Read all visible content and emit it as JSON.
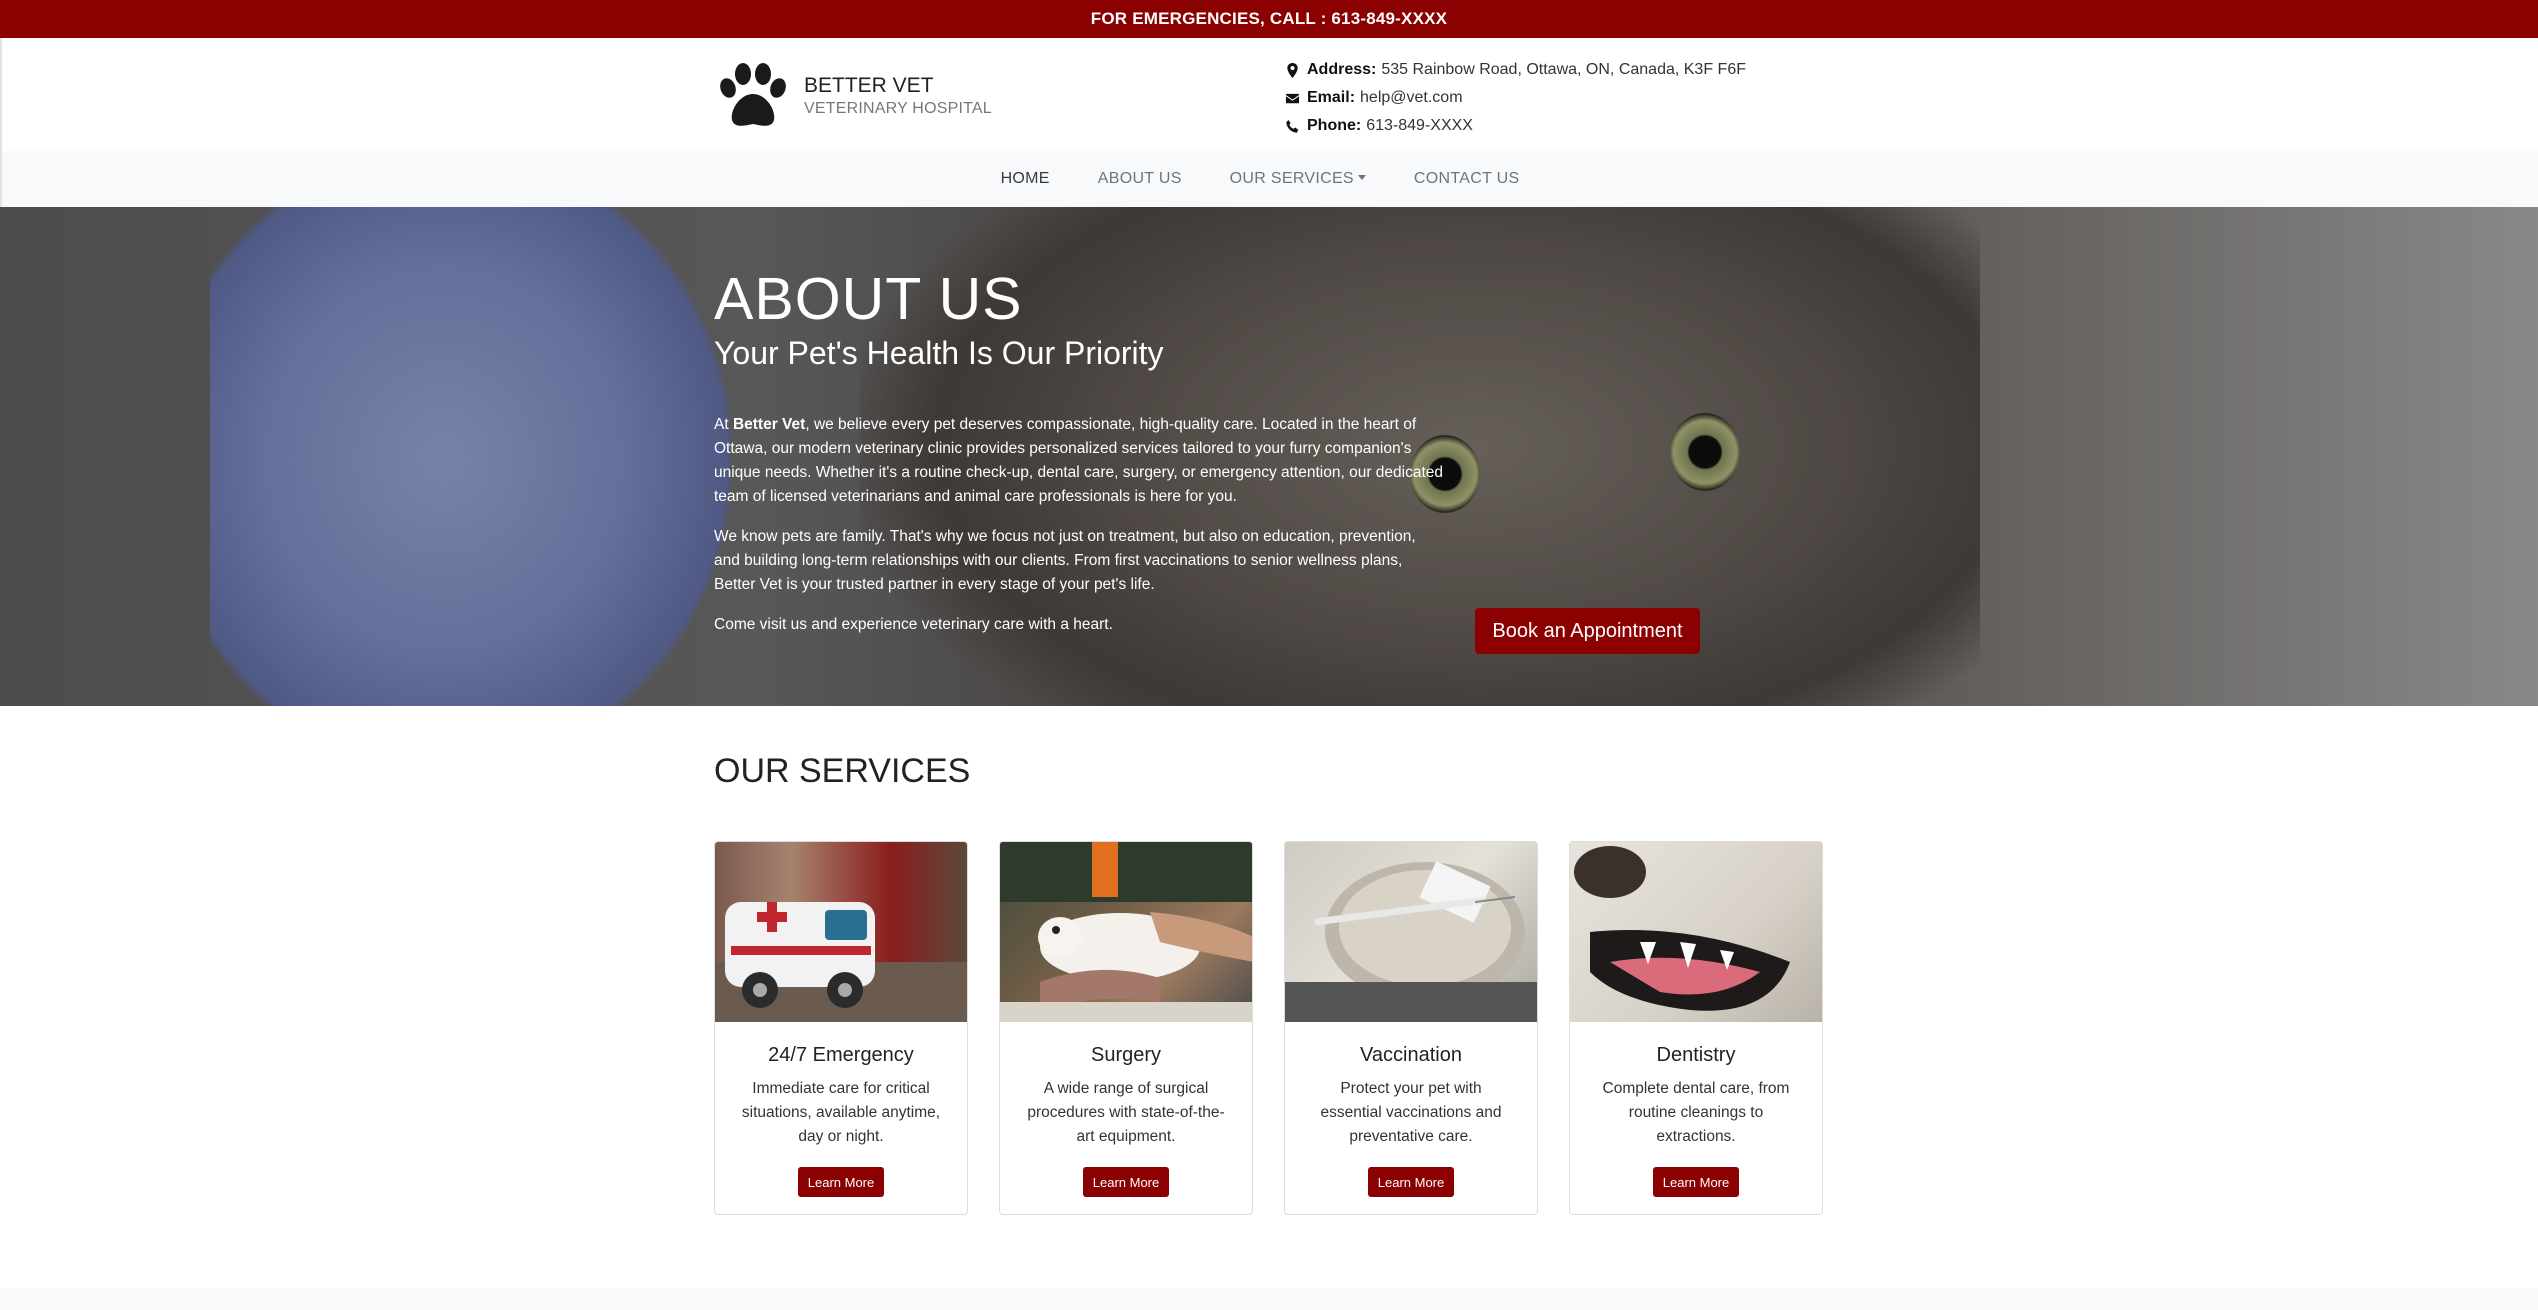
{
  "emergency": {
    "text": "FOR EMERGENCIES, CALL : 613-849-XXXX"
  },
  "brand": {
    "name": "BETTER VET",
    "tagline": "VETERINARY HOSPITAL",
    "logo_icon": "paw-icon"
  },
  "contact": {
    "address_label": "Address:",
    "address": "535 Rainbow Road, Ottawa, ON, Canada, K3F F6F",
    "email_label": "Email:",
    "email": "help@vet.com",
    "phone_label": "Phone:",
    "phone": "613-849-XXXX"
  },
  "nav": {
    "home": "HOME",
    "about": "ABOUT US",
    "services": "OUR SERVICES",
    "contact": "CONTACT US"
  },
  "hero": {
    "title": "ABOUT US",
    "subtitle": "Your Pet's Health Is Our Priority",
    "p1_prefix": "At ",
    "p1_brand": "Better Vet",
    "p1_rest": ", we believe every pet deserves compassionate, high-quality care. Located in the heart of Ottawa, our modern veterinary clinic provides personalized services tailored to your furry companion's unique needs. Whether it's a routine check-up, dental care, surgery, or emergency attention, our dedicated team of licensed veterinarians and animal care professionals is here for you.",
    "p2": "We know pets are family. That's why we focus not just on treatment, but also on education, prevention, and building long-term relationships with our clients. From first vaccinations to senior wellness plans, Better Vet is your trusted partner in every stage of your pet's life.",
    "p3": "Come visit us and experience veterinary care with a heart.",
    "cta": "Book an Appointment"
  },
  "services": {
    "title": "OUR SERVICES",
    "items": [
      {
        "title": "24/7 Emergency",
        "text": "Immediate care for critical situations, available anytime, day or night.",
        "button": "Learn More"
      },
      {
        "title": "Surgery",
        "text": "A wide range of surgical procedures with state-of-the-art equipment.",
        "button": "Learn More"
      },
      {
        "title": "Vaccination",
        "text": "Protect your pet with essential vaccinations and preventative care.",
        "button": "Learn More"
      },
      {
        "title": "Dentistry",
        "text": "Complete dental care, from routine cleanings to extractions.",
        "button": "Learn More"
      }
    ]
  },
  "colors": {
    "brand_red": "#8b0000",
    "nav_bg": "#f8f9fa"
  }
}
